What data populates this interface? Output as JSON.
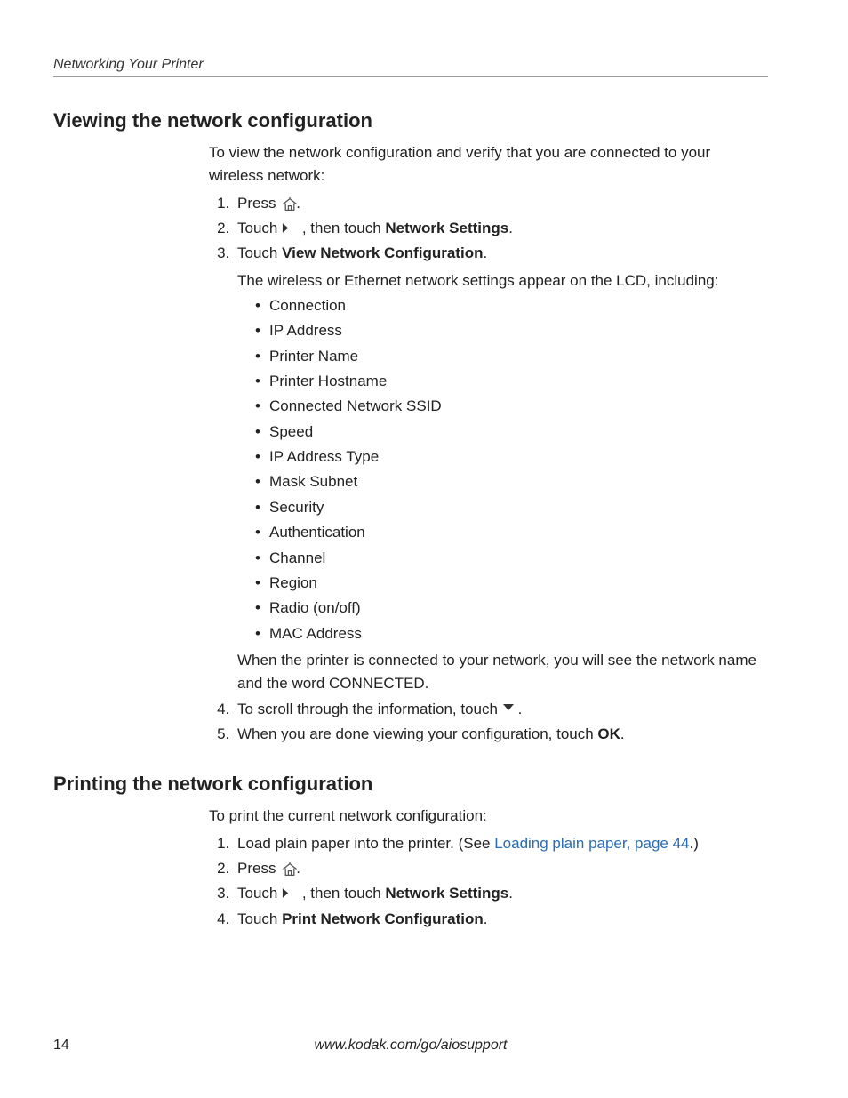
{
  "header": {
    "running": "Networking Your Printer"
  },
  "section1": {
    "title": "Viewing the network configuration",
    "intro": "To view the network configuration and verify that you are connected to your wireless network:",
    "step1_a": "Press ",
    "step1_b": ".",
    "step2_a": "Touch ",
    "step2_b": " , then touch ",
    "step2_bold": "Network Settings",
    "step2_c": ".",
    "step3_a": "Touch ",
    "step3_bold": "View Network Configuration",
    "step3_b": ".",
    "step3_sub": "The wireless or Ethernet network settings appear on the LCD, including:",
    "bullets": [
      "Connection",
      "IP Address",
      "Printer Name",
      "Printer Hostname",
      "Connected Network SSID",
      "Speed",
      "IP Address Type",
      "Mask Subnet",
      "Security",
      "Authentication",
      "Channel",
      "Region",
      "Radio (on/off)",
      "MAC Address"
    ],
    "after_bullets": "When the printer is connected to your network, you will see the network name and the word CONNECTED.",
    "step4_a": "To scroll through the information, touch ",
    "step4_b": ".",
    "step5_a": "When you are done viewing your configuration, touch ",
    "step5_bold": "OK",
    "step5_b": "."
  },
  "section2": {
    "title": "Printing the network configuration",
    "intro": "To print the current network configuration:",
    "step1_a": "Load plain paper into the printer. (See ",
    "step1_link": "Loading plain paper, page 44",
    "step1_b": ".)",
    "step2_a": "Press ",
    "step2_b": ".",
    "step3_a": "Touch ",
    "step3_b": " , then touch ",
    "step3_bold": "Network Settings",
    "step3_c": ".",
    "step4_a": "Touch ",
    "step4_bold": "Print Network Configuration",
    "step4_b": "."
  },
  "footer": {
    "page_number": "14",
    "url": "www.kodak.com/go/aiosupport"
  }
}
